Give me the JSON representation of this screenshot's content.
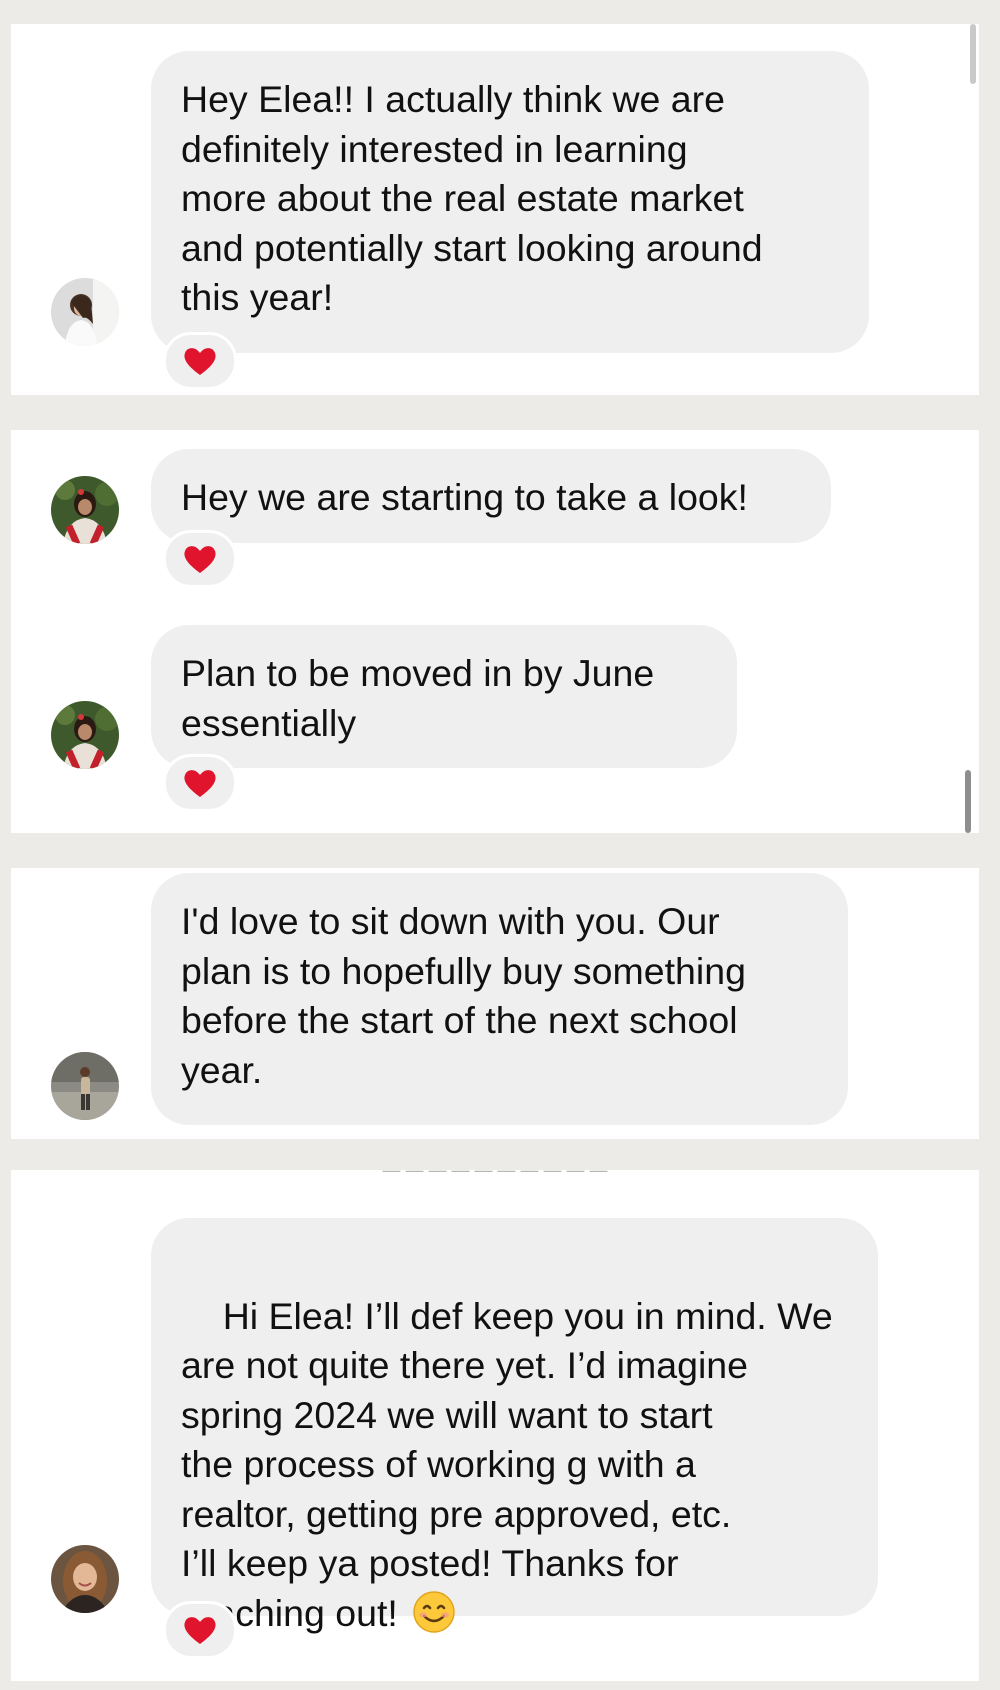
{
  "messages": [
    {
      "text": "Hey Elea!! I actually think we are\ndefinitely interested in learning\nmore about the real estate market\nand potentially start looking around\nthis year!",
      "reaction": "heart"
    },
    {
      "text": "Hey we are starting to take a look!",
      "reaction": "heart"
    },
    {
      "text": "Plan to be moved in by June\nessentially",
      "reaction": "heart"
    },
    {
      "text": "I'd love to sit down with you. Our\nplan is to hopefully buy something\nbefore the start of the next school\nyear.",
      "reaction": null
    },
    {
      "text": "Hi Elea! I’ll def keep you in mind. We\nare not quite there yet. I’d imagine\nspring 2024 we will want to start\nthe process of working g with a\nrealtor, getting pre approved, etc.\nI’ll keep ya posted! Thanks for\nreaching out!",
      "trailing_emoji": "smiling-face-emoji",
      "reaction": "heart"
    }
  ],
  "colors": {
    "bubble": "#efefef",
    "page_background": "#ecebe8",
    "card": "#ffffff",
    "heart": "#e0152d"
  }
}
